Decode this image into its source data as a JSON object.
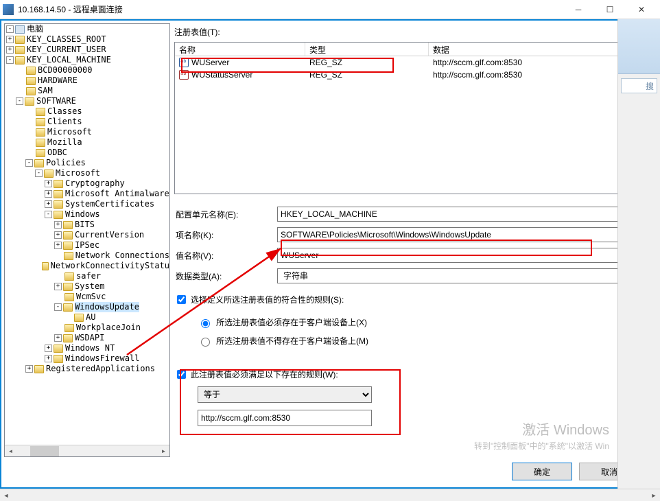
{
  "window": {
    "title": "10.168.14.50 - 远程桌面连接"
  },
  "labels": {
    "registry_value": "注册表值(T):",
    "hive_name": "配置单元名称(E):",
    "key_name": "项名称(K):",
    "value_name": "值名称(V):",
    "data_type": "数据类型(A):",
    "compliance_check": "选择定义所选注册表值的符合性的规则(S):",
    "radio_exist": "所选注册表值必须存在于客户端设备上(X)",
    "radio_not_exist": "所选注册表值不得存在于客户端设备上(M)",
    "rule_check": "此注册表值必须满足以下存在的规则(W):",
    "ok": "确定",
    "cancel": "取消"
  },
  "listview": {
    "columns": {
      "name": "名称",
      "type": "类型",
      "data": "数据"
    },
    "rows": [
      {
        "name": "WUServer",
        "type": "REG_SZ",
        "data": "http://sccm.glf.com:8530"
      },
      {
        "name": "WUStatusServer",
        "type": "REG_SZ",
        "data": "http://sccm.glf.com:8530"
      }
    ]
  },
  "fields": {
    "hive": "HKEY_LOCAL_MACHINE",
    "key": "SOFTWARE\\Policies\\Microsoft\\Windows\\WindowsUpdate",
    "value": "WUServer",
    "datatype": "字符串"
  },
  "rule": {
    "operator": "等于",
    "value": "http://sccm.glf.com:8530"
  },
  "tree": [
    {
      "d": 0,
      "exp": "-",
      "icon": "comp",
      "label": "电脑"
    },
    {
      "d": 0,
      "exp": "+",
      "icon": "f",
      "label": "KEY_CLASSES_ROOT"
    },
    {
      "d": 0,
      "exp": "+",
      "icon": "f",
      "label": "KEY_CURRENT_USER"
    },
    {
      "d": 0,
      "exp": "-",
      "icon": "f",
      "label": "KEY_LOCAL_MACHINE"
    },
    {
      "d": 1,
      "exp": "",
      "icon": "f",
      "label": "BCD00000000"
    },
    {
      "d": 1,
      "exp": "",
      "icon": "f",
      "label": "HARDWARE"
    },
    {
      "d": 1,
      "exp": "",
      "icon": "f",
      "label": "SAM"
    },
    {
      "d": 1,
      "exp": "-",
      "icon": "f",
      "label": "SOFTWARE"
    },
    {
      "d": 2,
      "exp": "",
      "icon": "f",
      "label": "Classes"
    },
    {
      "d": 2,
      "exp": "",
      "icon": "f",
      "label": "Clients"
    },
    {
      "d": 2,
      "exp": "",
      "icon": "f",
      "label": "Microsoft"
    },
    {
      "d": 2,
      "exp": "",
      "icon": "f",
      "label": "Mozilla"
    },
    {
      "d": 2,
      "exp": "",
      "icon": "f",
      "label": "ODBC"
    },
    {
      "d": 2,
      "exp": "-",
      "icon": "f",
      "label": "Policies"
    },
    {
      "d": 3,
      "exp": "-",
      "icon": "f",
      "label": "Microsoft"
    },
    {
      "d": 4,
      "exp": "+",
      "icon": "f",
      "label": "Cryptography"
    },
    {
      "d": 4,
      "exp": "+",
      "icon": "f",
      "label": "Microsoft Antimalware"
    },
    {
      "d": 4,
      "exp": "+",
      "icon": "f",
      "label": "SystemCertificates"
    },
    {
      "d": 4,
      "exp": "-",
      "icon": "f",
      "label": "Windows"
    },
    {
      "d": 5,
      "exp": "+",
      "icon": "f",
      "label": "BITS"
    },
    {
      "d": 5,
      "exp": "+",
      "icon": "f",
      "label": "CurrentVersion"
    },
    {
      "d": 5,
      "exp": "+",
      "icon": "f",
      "label": "IPSec"
    },
    {
      "d": 5,
      "exp": "",
      "icon": "f",
      "label": "Network Connections"
    },
    {
      "d": 5,
      "exp": "",
      "icon": "f",
      "label": "NetworkConnectivityStatu"
    },
    {
      "d": 5,
      "exp": "",
      "icon": "f",
      "label": "safer"
    },
    {
      "d": 5,
      "exp": "+",
      "icon": "f",
      "label": "System"
    },
    {
      "d": 5,
      "exp": "",
      "icon": "f",
      "label": "WcmSvc"
    },
    {
      "d": 5,
      "exp": "-",
      "icon": "f",
      "label": "WindowsUpdate",
      "sel": true
    },
    {
      "d": 6,
      "exp": "",
      "icon": "f",
      "label": "AU"
    },
    {
      "d": 5,
      "exp": "",
      "icon": "f",
      "label": "WorkplaceJoin"
    },
    {
      "d": 5,
      "exp": "+",
      "icon": "f",
      "label": "WSDAPI"
    },
    {
      "d": 4,
      "exp": "+",
      "icon": "f",
      "label": "Windows NT"
    },
    {
      "d": 4,
      "exp": "+",
      "icon": "f",
      "label": "WindowsFirewall"
    },
    {
      "d": 2,
      "exp": "+",
      "icon": "f",
      "label": "RegisteredApplications"
    }
  ],
  "watermark": {
    "title": "激活 Windows",
    "sub": "转到\"控制面板\"中的\"系统\"以激活 Win"
  },
  "gutter": {
    "search": "搜"
  }
}
